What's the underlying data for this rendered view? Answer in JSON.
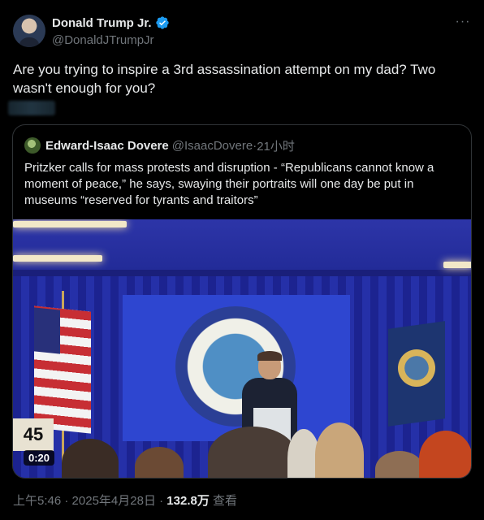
{
  "author": {
    "display_name": "Donald Trump Jr.",
    "handle": "@DonaldJTrumpJr",
    "verified": true
  },
  "more_icon_label": "···",
  "tweet": {
    "text": "Are you trying to inspire a 3rd assassination attempt on my dad? Two wasn't enough for you?"
  },
  "quoted": {
    "display_name": "Edward-Isaac Dovere",
    "handle": "@IsaacDovere",
    "separator": " · ",
    "time": "21小时",
    "text": "Pritzker calls for mass protests and disruption - “Republicans cannot know a moment of peace,” he says, swaying their portraits will one day be put in museums “reserved for tyrants and traitors”",
    "video": {
      "duration": "0:20",
      "sign_text": "45"
    }
  },
  "meta": {
    "time": "上午5:46",
    "sep1": " · ",
    "date": "2025年4月28日",
    "sep2": " · ",
    "views_count": "132.8万",
    "views_label": " 查看"
  },
  "colors": {
    "background": "#000000",
    "text_primary": "#e7e9ea",
    "text_secondary": "#71767b",
    "verified_blue": "#1d9bf0",
    "border": "#2f3336"
  }
}
